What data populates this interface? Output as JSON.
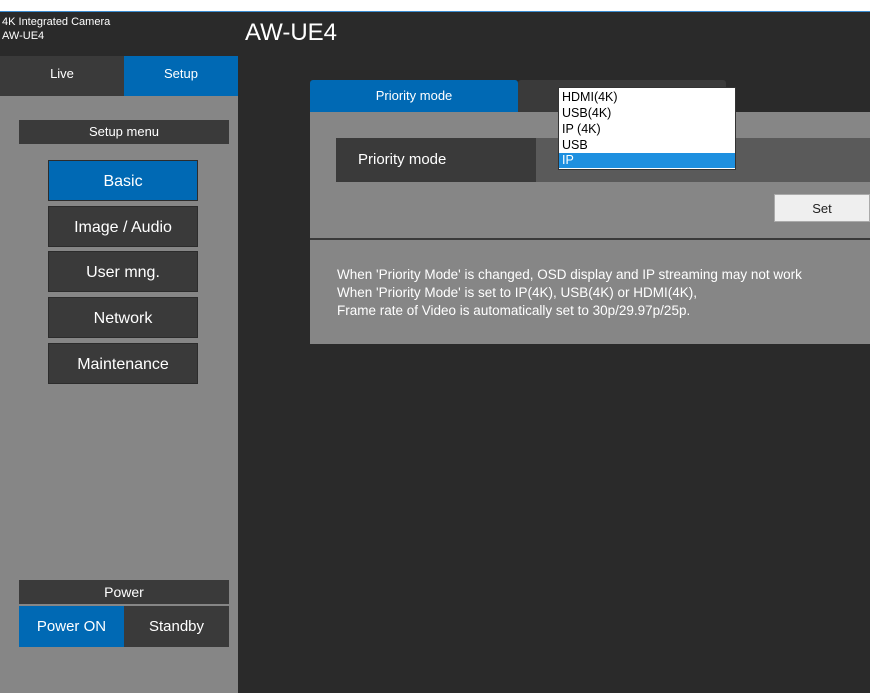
{
  "app": {
    "camera_title_line1": "4K Integrated Camera",
    "camera_title_line2": "AW-UE4",
    "page_title": "AW-UE4"
  },
  "top_tabs": {
    "live": "Live",
    "setup": "Setup"
  },
  "sidebar": {
    "menu_header": "Setup menu",
    "items": [
      {
        "label": "Basic",
        "active": true
      },
      {
        "label": "Image / Audio"
      },
      {
        "label": "User mng."
      },
      {
        "label": "Network"
      },
      {
        "label": "Maintenance"
      }
    ],
    "power_header": "Power",
    "power_on": "Power ON",
    "standby": "Standby"
  },
  "main": {
    "tabs": [
      {
        "label": "Priority mode",
        "active": true
      },
      {
        "label": ""
      }
    ],
    "priority_mode": {
      "label": "Priority mode",
      "options": [
        "HDMI(4K)",
        "USB(4K)",
        "IP (4K)",
        "USB",
        "IP"
      ],
      "selected": "IP"
    },
    "set_button": "Set",
    "notes": [
      "When 'Priority Mode' is changed, OSD display and IP streaming may not work",
      "When 'Priority Mode' is set to IP(4K), USB(4K) or HDMI(4K),",
      "Frame rate of Video is automatically set to 30p/29.97p/25p."
    ]
  },
  "colors": {
    "accent": "#0069b4",
    "dark": "#3a3a3a",
    "sidebar_bg": "#868686",
    "page_bg": "#2a2a2a",
    "highlight": "#1e90e0"
  }
}
